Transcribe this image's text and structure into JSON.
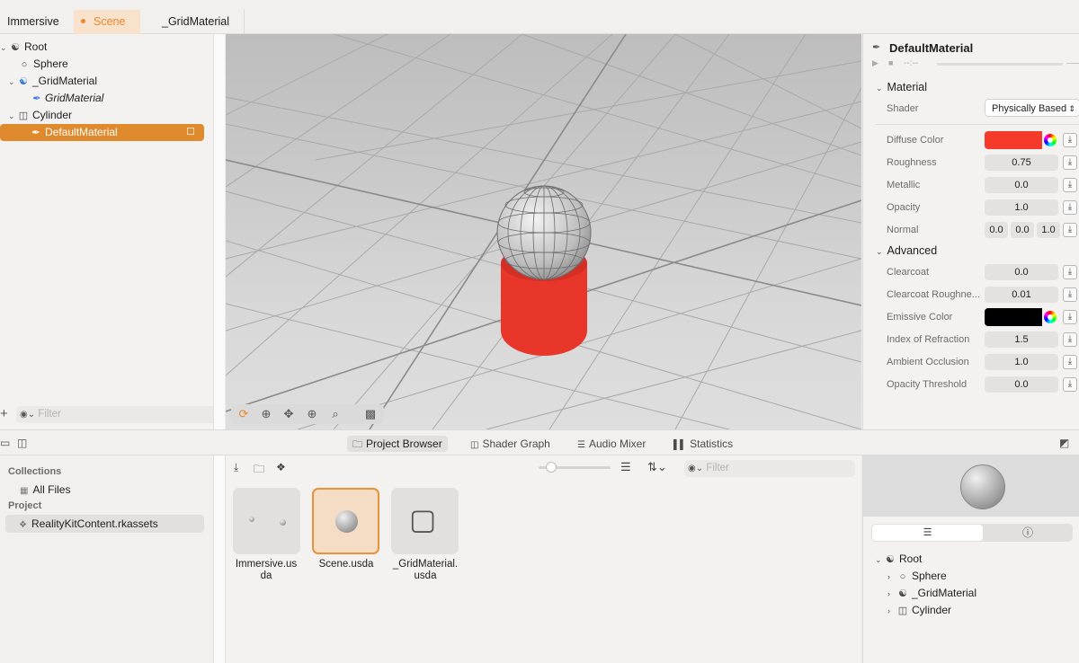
{
  "tabs": [
    {
      "label": "Immersive"
    },
    {
      "label": "Scene"
    },
    {
      "label": "_GridMaterial"
    }
  ],
  "outline": {
    "items": [
      {
        "label": "Root"
      },
      {
        "label": "Sphere"
      },
      {
        "label": "_GridMaterial"
      },
      {
        "label": "GridMaterial"
      },
      {
        "label": "Cylinder"
      },
      {
        "label": "DefaultMaterial"
      }
    ],
    "filter_placeholder": "Filter"
  },
  "inspector": {
    "title": "DefaultMaterial",
    "time": "--:--",
    "material_section": "Material",
    "shader_label": "Shader",
    "shader_value": "Physically Based",
    "diffuse_label": "Diffuse Color",
    "diffuse_color": "#f5392b",
    "roughness_label": "Roughness",
    "roughness_value": "0.75",
    "metallic_label": "Metallic",
    "metallic_value": "0.0",
    "opacity_label": "Opacity",
    "opacity_value": "1.0",
    "normal_label": "Normal",
    "normal_values": [
      "0.0",
      "0.0",
      "1.0"
    ],
    "advanced_section": "Advanced",
    "clearcoat_label": "Clearcoat",
    "clearcoat_value": "0.0",
    "clearcoat_rough_label": "Clearcoat Roughne...",
    "clearcoat_rough_value": "0.01",
    "emissive_label": "Emissive Color",
    "emissive_color": "#000000",
    "ior_label": "Index of Refraction",
    "ior_value": "1.5",
    "ao_label": "Ambient Occlusion",
    "ao_value": "1.0",
    "opacity_threshold_label": "Opacity Threshold",
    "opacity_threshold_value": "0.0"
  },
  "bottom_tabs": [
    {
      "label": "Project Browser"
    },
    {
      "label": "Shader Graph"
    },
    {
      "label": "Audio Mixer"
    },
    {
      "label": "Statistics"
    }
  ],
  "collections": {
    "header": "Collections",
    "all_files": "All Files",
    "project_header": "Project",
    "project_item": "RealityKitContent.rkassets"
  },
  "browser": {
    "filter_placeholder": "Filter",
    "assets": [
      {
        "name": "Immersive.us\nda"
      },
      {
        "name": "Scene.usda"
      },
      {
        "name": "_GridMaterial.\nusda"
      }
    ]
  },
  "preview_tree": {
    "items": [
      {
        "label": "Root"
      },
      {
        "label": "Sphere"
      },
      {
        "label": "_GridMaterial"
      },
      {
        "label": "Cylinder"
      }
    ]
  },
  "accent_color": "#e8892c"
}
